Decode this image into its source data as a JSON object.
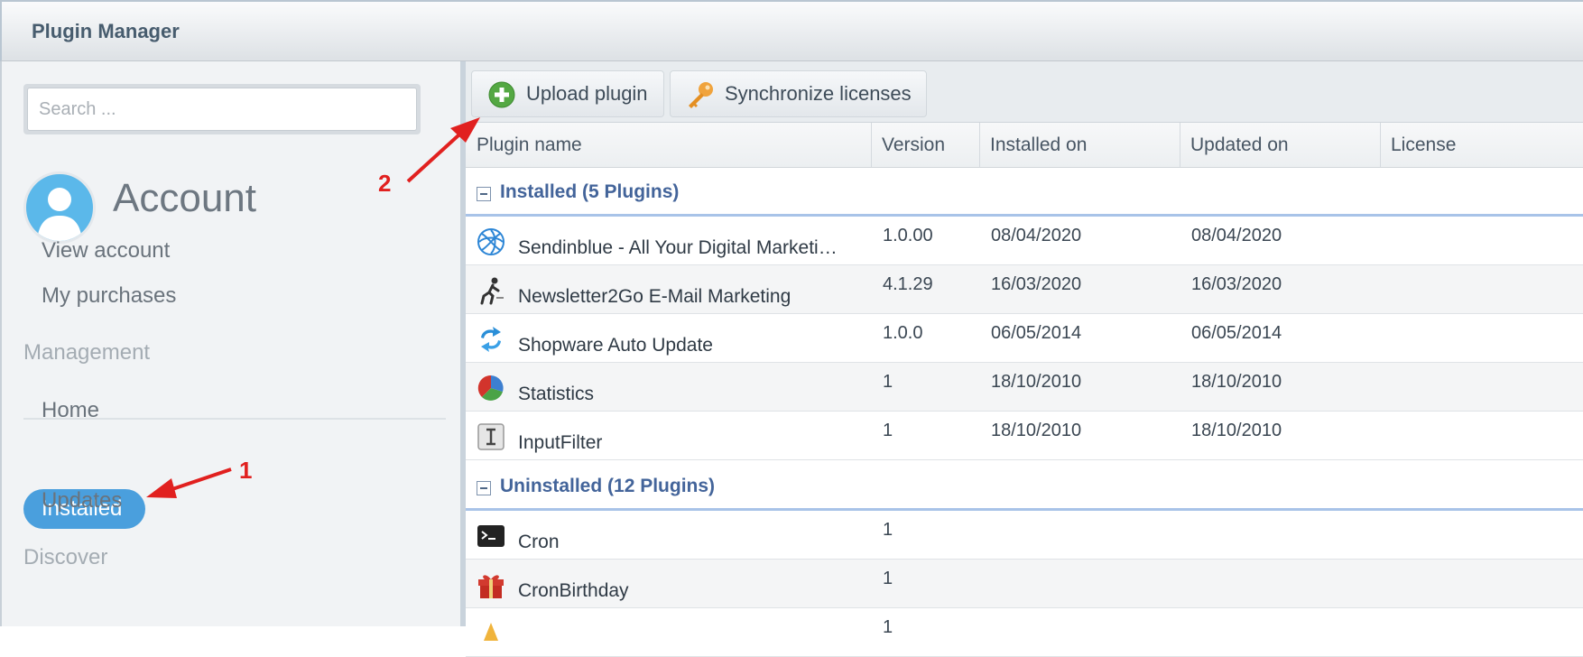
{
  "window": {
    "title": "Plugin Manager"
  },
  "sidebar": {
    "search": {
      "placeholder": "Search ...",
      "value": ""
    },
    "account": {
      "title": "Account"
    },
    "account_links": [
      "View account",
      "My purchases"
    ],
    "management": {
      "heading": "Management",
      "items": [
        "Home",
        "Installed",
        "Updates"
      ],
      "active": "Installed"
    },
    "discover": {
      "heading": "Discover"
    }
  },
  "toolbar": {
    "upload_label": "Upload plugin",
    "sync_label": "Synchronize licenses"
  },
  "grid": {
    "columns": [
      "Plugin name",
      "Version",
      "Installed on",
      "Updated on",
      "License"
    ],
    "groups": [
      {
        "label": "Installed (5 Plugins)",
        "rows": [
          {
            "name": "Sendinblue - All Your Digital Marketi…",
            "version": "1.0.00",
            "installed": "08/04/2020",
            "updated": "08/04/2020",
            "license": "",
            "icon": "sendinblue-icon"
          },
          {
            "name": "Newsletter2Go E-Mail Marketing",
            "version": "4.1.29",
            "installed": "16/03/2020",
            "updated": "16/03/2020",
            "license": "",
            "icon": "newsletter2go-icon"
          },
          {
            "name": "Shopware Auto Update",
            "version": "1.0.0",
            "installed": "06/05/2014",
            "updated": "06/05/2014",
            "license": "",
            "icon": "auto-update-icon"
          },
          {
            "name": "Statistics",
            "version": "1",
            "installed": "18/10/2010",
            "updated": "18/10/2010",
            "license": "",
            "icon": "statistics-icon"
          },
          {
            "name": "InputFilter",
            "version": "1",
            "installed": "18/10/2010",
            "updated": "18/10/2010",
            "license": "",
            "icon": "input-filter-icon"
          }
        ]
      },
      {
        "label": "Uninstalled (12 Plugins)",
        "rows": [
          {
            "name": "Cron",
            "version": "1",
            "installed": "",
            "updated": "",
            "license": "",
            "icon": "terminal-icon"
          },
          {
            "name": "CronBirthday",
            "version": "1",
            "installed": "",
            "updated": "",
            "license": "",
            "icon": "gift-icon"
          },
          {
            "name": "",
            "version": "1",
            "installed": "",
            "updated": "",
            "license": "",
            "icon": "partial-icon"
          }
        ]
      }
    ]
  },
  "annotations": {
    "arrow_1": "1",
    "arrow_2": "2"
  },
  "colors": {
    "accent": "#4a9fdd",
    "group_text": "#43649a",
    "annotation": "#e1201f"
  }
}
